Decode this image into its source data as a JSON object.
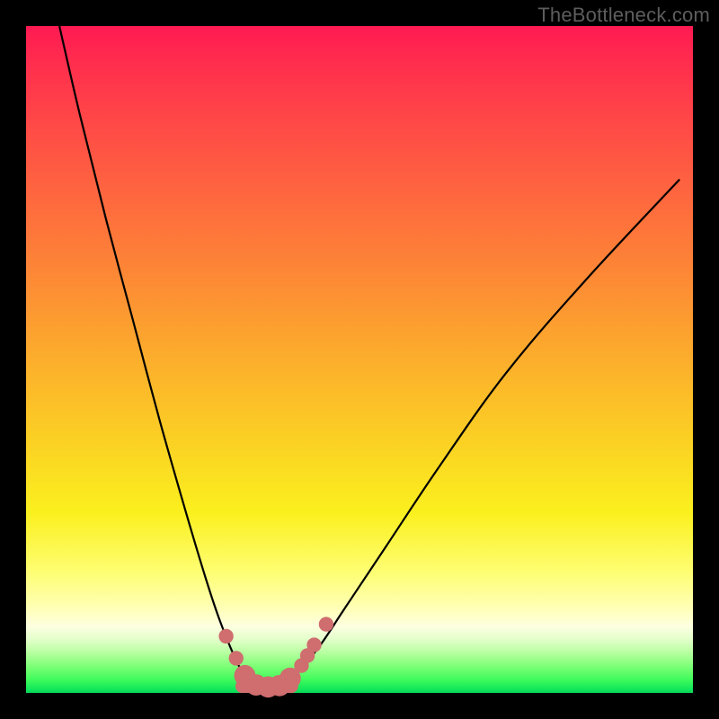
{
  "watermark": "TheBottleneck.com",
  "colors": {
    "frame": "#000000",
    "curve_stroke": "#000000",
    "marker_fill": "#cf6d6f",
    "marker_stroke": "#cf6d6f"
  },
  "chart_data": {
    "type": "line",
    "title": "",
    "xlabel": "",
    "ylabel": "",
    "xlim": [
      0,
      100
    ],
    "ylim": [
      0,
      100
    ],
    "series": [
      {
        "name": "bottleneck-curve",
        "x": [
          5,
          8,
          12,
          16,
          20,
          24,
          27,
          29,
          31,
          32.5,
          34,
          35.5,
          37,
          39,
          41,
          44,
          48,
          54,
          62,
          72,
          84,
          98
        ],
        "y": [
          100,
          87,
          71,
          56,
          41,
          27,
          17,
          11,
          6,
          3,
          1.5,
          0.8,
          0.8,
          1.6,
          3.5,
          7,
          13,
          22,
          34,
          48,
          62,
          77
        ]
      }
    ],
    "markers": [
      {
        "x": 30.0,
        "y": 8.5,
        "r": 1.1
      },
      {
        "x": 31.5,
        "y": 5.2,
        "r": 1.1
      },
      {
        "x": 32.8,
        "y": 2.6,
        "r": 1.6
      },
      {
        "x": 34.5,
        "y": 1.2,
        "r": 1.6
      },
      {
        "x": 36.3,
        "y": 0.9,
        "r": 1.6
      },
      {
        "x": 38.0,
        "y": 1.1,
        "r": 1.6
      },
      {
        "x": 39.6,
        "y": 2.2,
        "r": 1.6
      },
      {
        "x": 41.3,
        "y": 4.1,
        "r": 1.1
      },
      {
        "x": 42.2,
        "y": 5.6,
        "r": 1.1
      },
      {
        "x": 43.2,
        "y": 7.2,
        "r": 1.1
      },
      {
        "x": 45.0,
        "y": 10.3,
        "r": 1.1
      }
    ],
    "bottom_marker_segment": {
      "x1": 32.4,
      "x2": 39.8,
      "y": 1.0,
      "stroke_width_pct": 2.0
    }
  }
}
